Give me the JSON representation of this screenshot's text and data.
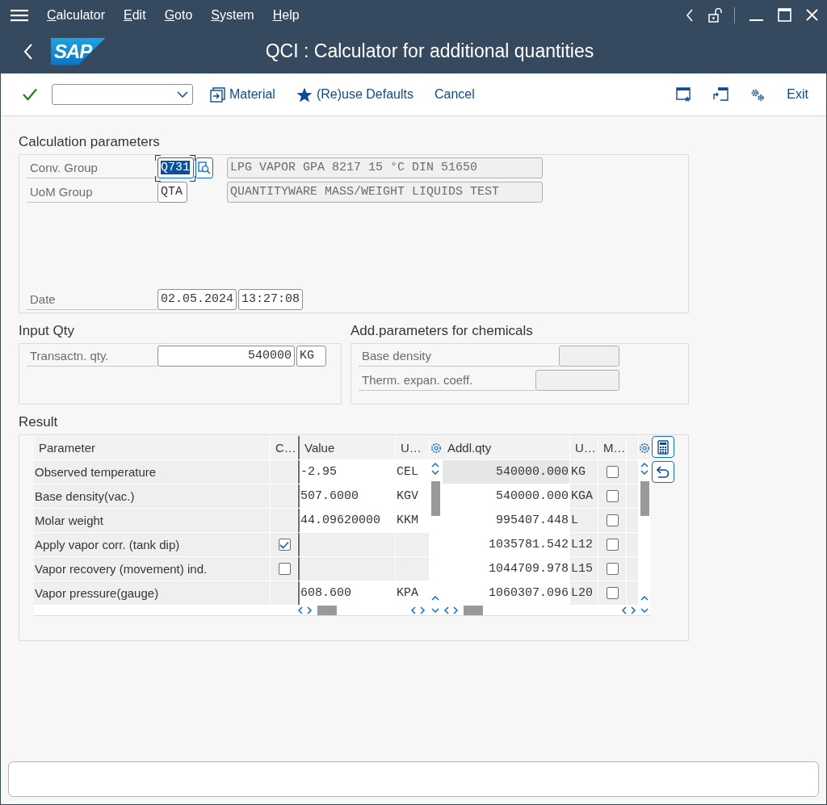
{
  "menu_bar": {
    "items": [
      "Calculator",
      "Edit",
      "Goto",
      "System",
      "Help"
    ]
  },
  "title_bar": {
    "logo": "SAP",
    "title": "QCI : Calculator for additional quantities"
  },
  "toolbar": {
    "buttons": [
      {
        "kind": "material",
        "label": "Material"
      },
      {
        "kind": "star",
        "label": "(Re)use Defaults"
      },
      {
        "kind": "text",
        "label": "Cancel"
      }
    ],
    "exit": "Exit"
  },
  "calculation_parameters": {
    "title": "Calculation parameters",
    "fields": [
      {
        "label": "Conv. Group",
        "value": "Q731",
        "description": "LPG VAPOR GPA 8217 15 °C DIN 51650",
        "focused": true
      },
      {
        "label": "UoM Group",
        "value": "QTA",
        "description": "QUANTITYWARE MASS/WEIGHT LIQUIDS TEST",
        "focused": false
      }
    ],
    "date": {
      "label": "Date",
      "date": "02.05.2024",
      "time": "13:27:08"
    }
  },
  "input_qty": {
    "title": "Input Qty",
    "label": "Transactn. qty.",
    "value": "540000",
    "unit": "KG"
  },
  "chemicals": {
    "title": "Add.parameters for chemicals",
    "fields": [
      {
        "label": "Base density"
      },
      {
        "label": "Therm. expan. coeff."
      }
    ]
  },
  "result": {
    "title": "Result",
    "parameters": {
      "columns": [
        "Parameter",
        "C…",
        "Value",
        "U…"
      ],
      "rows": [
        {
          "kind": "value",
          "parameter": "Observed temperature",
          "value": "-2.95",
          "unit": "CEL"
        },
        {
          "kind": "value",
          "parameter": "Base density(vac.)",
          "value": "507.6000",
          "unit": "KGV"
        },
        {
          "kind": "value",
          "parameter": "Molar weight",
          "value": "44.09620000",
          "unit": "KKM"
        },
        {
          "kind": "checkbox",
          "parameter": "Apply vapor corr. (tank dip)",
          "checked": true
        },
        {
          "kind": "checkbox",
          "parameter": "Vapor recovery (movement) ind.",
          "checked": false
        },
        {
          "kind": "value",
          "parameter": "Vapor pressure(gauge)",
          "value": "608.600",
          "unit": "KPA"
        }
      ]
    },
    "quantities": {
      "columns": [
        "Addl.qty",
        "U…",
        "M…"
      ],
      "rows": [
        {
          "quantity": "540000.000",
          "unit": "KG",
          "marked": false,
          "selected": true
        },
        {
          "quantity": "540000.000",
          "unit": "KGA",
          "marked": false,
          "selected": false
        },
        {
          "quantity": "995407.448",
          "unit": "L",
          "marked": false,
          "selected": false
        },
        {
          "quantity": "1035781.542",
          "unit": "L12",
          "marked": false,
          "selected": false
        },
        {
          "quantity": "1044709.978",
          "unit": "L15",
          "marked": false,
          "selected": false
        },
        {
          "quantity": "1060307.096",
          "unit": "L20",
          "marked": false,
          "selected": false
        }
      ]
    }
  }
}
